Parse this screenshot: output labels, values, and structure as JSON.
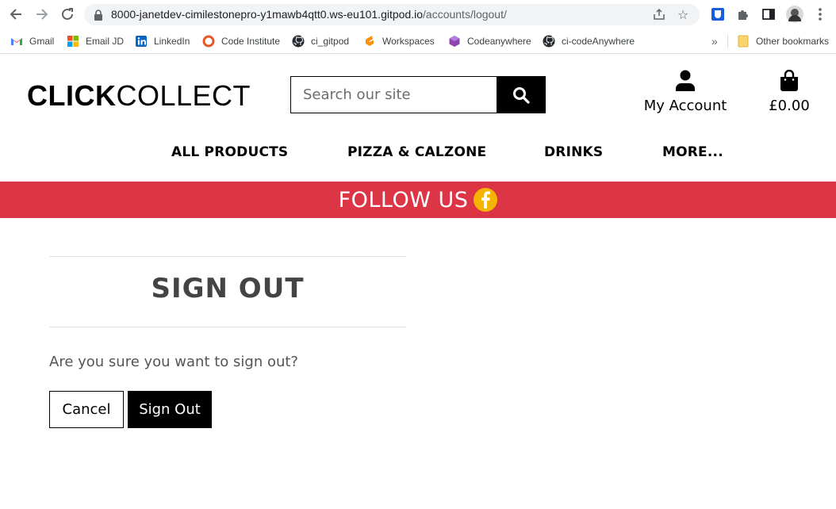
{
  "browser": {
    "url_host": "8000-janetdev-cimilestonepro-y1mawb4qtt0.ws-eu101.gitpod.io",
    "url_path": "/accounts/logout/",
    "bookmarks": [
      {
        "label": "Gmail",
        "icon": "gmail-icon"
      },
      {
        "label": "Email JD",
        "icon": "microsoft-icon"
      },
      {
        "label": "LinkedIn",
        "icon": "linkedin-icon"
      },
      {
        "label": "Code Institute",
        "icon": "code-institute-icon"
      },
      {
        "label": "ci_gitpod",
        "icon": "github-icon"
      },
      {
        "label": "Workspaces",
        "icon": "gitpod-icon"
      },
      {
        "label": "Codeanywhere",
        "icon": "codeanywhere-icon"
      },
      {
        "label": "ci-codeAnywhere",
        "icon": "github-icon"
      }
    ],
    "overflow_label": "»",
    "other_bookmarks": "Other bookmarks"
  },
  "site": {
    "logo_bold": "CLICK",
    "logo_light": "COLLECT",
    "search_placeholder": "Search our site",
    "account_label": "My Account",
    "bag_total": "£0.00",
    "nav": [
      "ALL PRODUCTS",
      "PIZZA & CALZONE",
      "DRINKS",
      "MORE..."
    ],
    "banner_text": "FOLLOW US",
    "banner_color": "#dc3545"
  },
  "content": {
    "title": "SIGN OUT",
    "question": "Are you sure you want to sign out?",
    "cancel_label": "Cancel",
    "signout_label": "Sign Out"
  }
}
